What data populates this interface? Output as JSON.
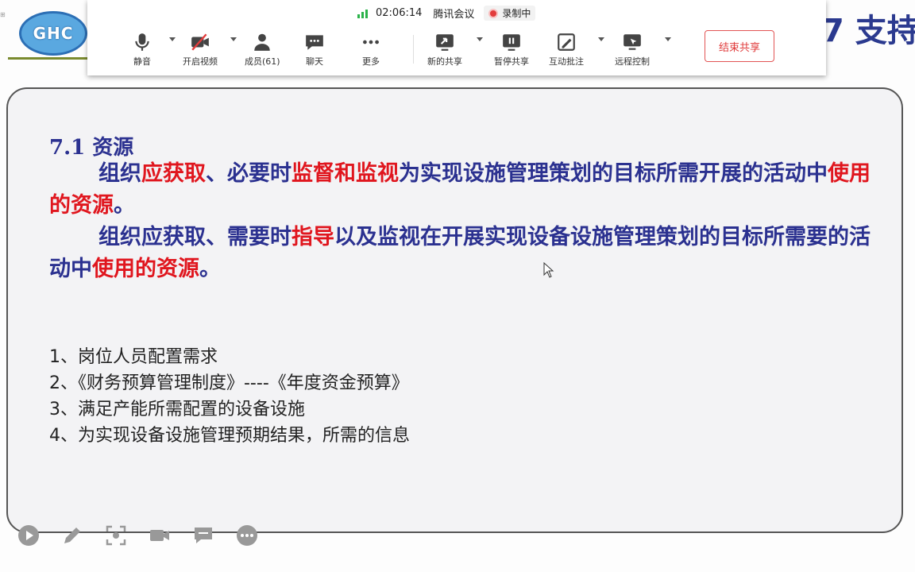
{
  "toolbar": {
    "time": "02:06:14",
    "app_name": "腾讯会议",
    "recording_label": "录制中",
    "buttons": {
      "mute": "静音",
      "video": "开启视频",
      "members": "成员(61)",
      "chat": "聊天",
      "more": "更多",
      "new_share": "新的共享",
      "pause_share": "暂停共享",
      "annotate": "互动批注",
      "remote_control": "远程控制"
    },
    "end_share": "结束共享",
    "colors": {
      "signal": "#2bb34a",
      "record_dot": "#e23c3c",
      "end_share": "#e03b3b"
    }
  },
  "slide": {
    "logo_text": "GHC",
    "title": "7 支持",
    "section_heading": "7.1 资源",
    "para1": [
      {
        "text": "组织",
        "hl": false
      },
      {
        "text": "应获取",
        "hl": true
      },
      {
        "text": "、必要时",
        "hl": false
      },
      {
        "text": "监督和监视",
        "hl": true
      },
      {
        "text": "为实现设施管理策划的目标所需开展的活动中",
        "hl": false
      },
      {
        "text": "使用的资源",
        "hl": true
      },
      {
        "text": "。",
        "hl": false
      }
    ],
    "para2": [
      {
        "text": "组织应获取、需要时",
        "hl": false
      },
      {
        "text": "指导",
        "hl": true
      },
      {
        "text": "以及监视在开展实现设备设施管理策划的目标所需要的活动中",
        "hl": false
      },
      {
        "text": "使用的资源",
        "hl": true
      },
      {
        "text": "。",
        "hl": false
      }
    ],
    "list": [
      "1、岗位人员配置需求",
      "2、《财务预算管理制度》----《年度资金预算》",
      "3、满足产能所需配置的设备设施",
      "4、为实现设备设施管理预期结果，所需的信息"
    ],
    "colors": {
      "text": "#2b3190",
      "highlight": "#e0161e"
    }
  },
  "annotation_tools": [
    "play-icon",
    "pen-icon",
    "screenshot-icon",
    "camera-icon",
    "comment-icon",
    "more-icon"
  ]
}
